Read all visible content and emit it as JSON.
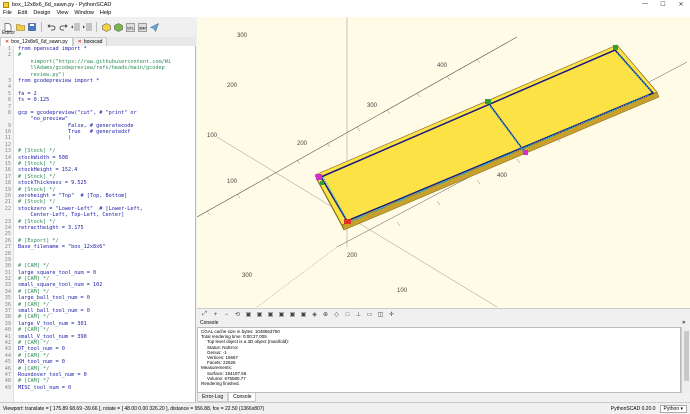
{
  "window": {
    "title": "box_12x8x6_6d_sawn.py - PythonSCAD",
    "minimize": "—",
    "maximize": "☐",
    "close": "✕"
  },
  "menu": [
    "File",
    "Edit",
    "Design",
    "View",
    "Window",
    "Help"
  ],
  "toolbar": {
    "icons": [
      "new-icon",
      "open-icon",
      "save-icon",
      "undo-icon",
      "redo-icon",
      "unindent-icon",
      "indent-icon",
      "preview-icon",
      "render-icon",
      "export-stl-icon",
      "export-3mf-icon",
      "send-icon"
    ]
  },
  "editor": {
    "label": "Editor",
    "tabs": [
      {
        "label": "box_12x8x6_6d_sawn.py",
        "active": true
      },
      {
        "label": "boxscad",
        "active": false
      }
    ],
    "lines": [
      {
        "n": "1",
        "t": "from openscad import *",
        "c": false
      },
      {
        "n": "2",
        "t": "#",
        "c": true
      },
      {
        "n": "",
        "t": "    nimport(\"https://raw.githubusercontent.com/Wi",
        "c": true
      },
      {
        "n": "",
        "t": "    llAdams/gcodepreview/refs/heads/main/gcodep",
        "c": true
      },
      {
        "n": "",
        "t": "    review.py\")",
        "c": true
      },
      {
        "n": "3",
        "t": "from gcodepreview import *",
        "c": false
      },
      {
        "n": "4",
        "t": "",
        "c": false
      },
      {
        "n": "5",
        "t": "fa = 2",
        "c": false
      },
      {
        "n": "6",
        "t": "fs = 0.125",
        "c": false
      },
      {
        "n": "7",
        "t": "",
        "c": false
      },
      {
        "n": "8",
        "t": "gcp = gcodepreview(\"cut\", # \"print\" or",
        "c": false
      },
      {
        "n": "",
        "t": "    \"no_preview\"",
        "c": false
      },
      {
        "n": "9",
        "t": "                False, # generatecode",
        "c": false
      },
      {
        "n": "10",
        "t": "                True   # generatedxf",
        "c": false
      },
      {
        "n": "11",
        "t": "                )",
        "c": false
      },
      {
        "n": "12",
        "t": "",
        "c": false
      },
      {
        "n": "13",
        "t": "# [Stock] */",
        "c": true
      },
      {
        "n": "14",
        "t": "stockWidth = 508",
        "c": false
      },
      {
        "n": "15",
        "t": "# [Stock] */",
        "c": true
      },
      {
        "n": "16",
        "t": "stockHeight = 152.4",
        "c": false
      },
      {
        "n": "17",
        "t": "# [Stock] */",
        "c": true
      },
      {
        "n": "18",
        "t": "stockThickness = 9.525",
        "c": false
      },
      {
        "n": "19",
        "t": "# [Stock] */",
        "c": true
      },
      {
        "n": "20",
        "t": "zeroheight = \"Top\"  # [Top, Bottom]",
        "c": false
      },
      {
        "n": "21",
        "t": "# [Stock] */",
        "c": true
      },
      {
        "n": "22",
        "t": "stockzero = \"Lower-Left\"  # [Lower-Left,",
        "c": false
      },
      {
        "n": "",
        "t": "    Center-Left, Top-Left, Center]",
        "c": false
      },
      {
        "n": "23",
        "t": "# [Stock] */",
        "c": true
      },
      {
        "n": "24",
        "t": "retractheight = 3.175",
        "c": false
      },
      {
        "n": "25",
        "t": "",
        "c": false
      },
      {
        "n": "26",
        "t": "# [Export] */",
        "c": true
      },
      {
        "n": "27",
        "t": "Base_filename = \"box_12x8x6\"",
        "c": false
      },
      {
        "n": "28",
        "t": "",
        "c": false
      },
      {
        "n": "29",
        "t": "",
        "c": false
      },
      {
        "n": "30",
        "t": "# [CAM] */",
        "c": true
      },
      {
        "n": "31",
        "t": "large_square_tool_num = 0",
        "c": false
      },
      {
        "n": "32",
        "t": "# [CAM] */",
        "c": true
      },
      {
        "n": "33",
        "t": "small_square_tool_num = 102",
        "c": false
      },
      {
        "n": "34",
        "t": "# [CAM] */",
        "c": true
      },
      {
        "n": "35",
        "t": "large_ball_tool_num = 0",
        "c": false
      },
      {
        "n": "36",
        "t": "# [CAM] */",
        "c": true
      },
      {
        "n": "37",
        "t": "small_ball_tool_num = 0",
        "c": false
      },
      {
        "n": "38",
        "t": "# [CAM] */",
        "c": true
      },
      {
        "n": "39",
        "t": "large_V_tool_num = 301",
        "c": false
      },
      {
        "n": "40",
        "t": "# [CAM] */",
        "c": true
      },
      {
        "n": "41",
        "t": "small_V_tool_num = 390",
        "c": false
      },
      {
        "n": "42",
        "t": "# [CAM] */",
        "c": true
      },
      {
        "n": "43",
        "t": "DT_tool_num = 0",
        "c": false
      },
      {
        "n": "44",
        "t": "# [CAM] */",
        "c": true
      },
      {
        "n": "45",
        "t": "KH_tool_num = 0",
        "c": false
      },
      {
        "n": "46",
        "t": "# [CAM] */",
        "c": true
      },
      {
        "n": "47",
        "t": "Roundover_tool_num = 0",
        "c": false
      },
      {
        "n": "48",
        "t": "# [CAM] */",
        "c": true
      },
      {
        "n": "49",
        "t": "MISC_tool_num = 0",
        "c": false
      }
    ]
  },
  "viewport": {
    "axis_labels": [
      "100",
      "200",
      "300",
      "400",
      "100",
      "200",
      "300",
      "400",
      "100",
      "200",
      "300"
    ]
  },
  "viewport_toolbar": {
    "icons": [
      "zoom-all-icon",
      "zoom-in-icon",
      "zoom-out-icon",
      "reset-view-icon",
      "view-right-icon",
      "view-top-icon",
      "view-bottom-icon",
      "view-left-icon",
      "view-front-icon",
      "view-back-icon",
      "view-diagonal-icon",
      "view-center-icon",
      "perspective-icon",
      "orthogonal-icon",
      "axes-icon",
      "scale-icon",
      "edges-icon",
      "crosshairs-icon"
    ]
  },
  "console": {
    "title": "Console",
    "close": "✕",
    "lines": [
      {
        "t": "CGAL cache size in bytes: 1048563750",
        "ind": false
      },
      {
        "t": "Total rendering time: 0:00:27.005",
        "ind": false
      },
      {
        "t": "Top level object is a 3D object (manifold):",
        "ind": true
      },
      {
        "t": "Status:    NoError",
        "ind": true
      },
      {
        "t": "Genus:      -1",
        "ind": true
      },
      {
        "t": "Vertices:    15667",
        "ind": true
      },
      {
        "t": "Facets:     22926",
        "ind": true
      },
      {
        "t": "Measurements:",
        "ind": false
      },
      {
        "t": "Surface: 184197.56",
        "ind": true
      },
      {
        "t": "Volume: 675580.77",
        "ind": true
      },
      {
        "t": "Rendering finished.",
        "ind": false
      }
    ]
  },
  "bottom_tabs": [
    {
      "label": "Error-Log",
      "active": false
    },
    {
      "label": "Console",
      "active": true
    }
  ],
  "statusbar": {
    "viewport": "Viewport: translate = [ 175.89 68.69 -39.66 ], rotate = [ 48.00 0.00 326.20 ], distance = 956.88, fov = 22.50 (1366x807)",
    "version": "PythonSCAD 0.20.0",
    "language": "Python ▾"
  }
}
